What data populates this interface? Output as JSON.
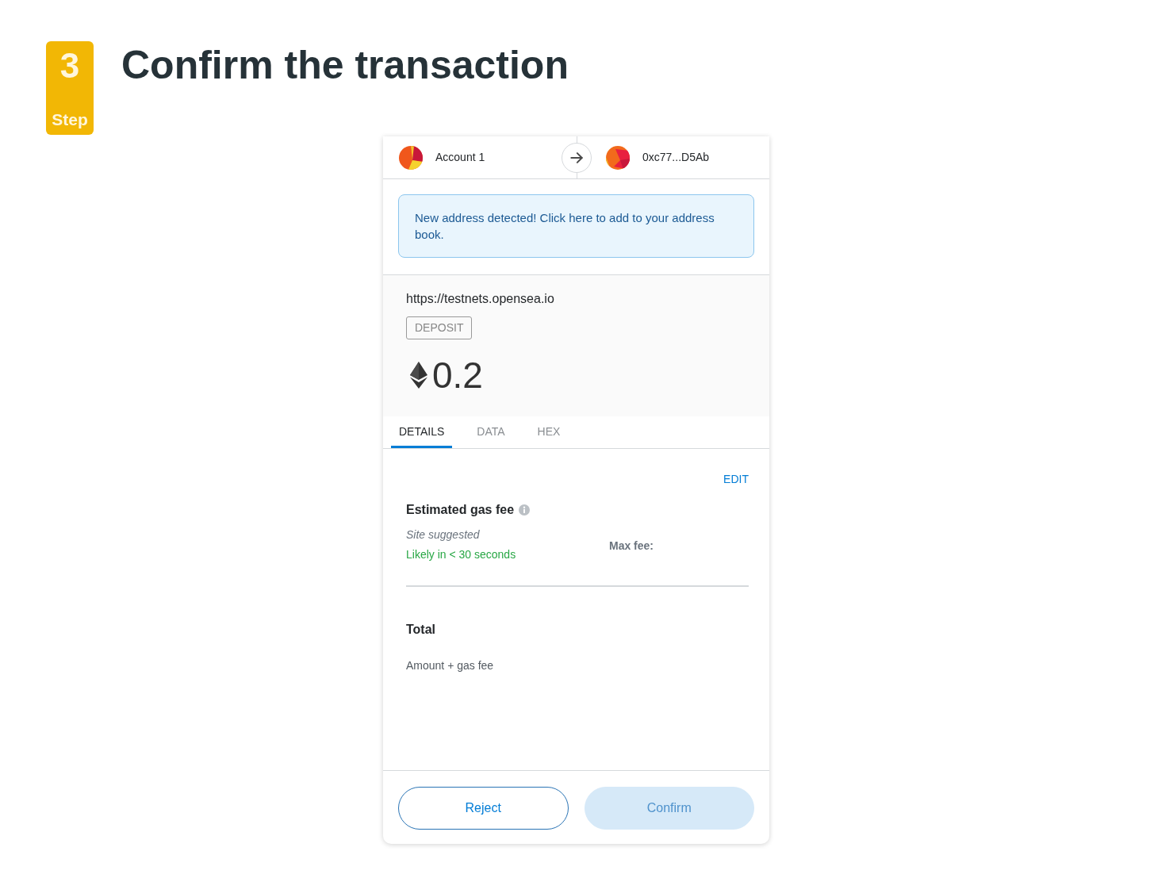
{
  "step": {
    "number": "3",
    "label": "Step"
  },
  "title": "Confirm the transaction",
  "header": {
    "from": "Account 1",
    "to": "0xc77...D5Ab"
  },
  "notice": "New address detected! Click here to add to your address book.",
  "origin": "https://testnets.opensea.io",
  "method": "DEPOSIT",
  "amount": "0.2",
  "tabs": [
    {
      "label": "DETAILS",
      "selected": true
    },
    {
      "label": "DATA",
      "selected": false
    },
    {
      "label": "HEX",
      "selected": false
    }
  ],
  "gas": {
    "edit": "EDIT",
    "label": "Estimated gas fee",
    "source": "Site suggested",
    "speed": "Likely in < 30 seconds",
    "max_fee_label": "Max fee:"
  },
  "total": {
    "label": "Total",
    "sublabel": "Amount + gas fee"
  },
  "buttons": [
    {
      "label": "Reject",
      "kind": "secondary",
      "disabled": false
    },
    {
      "label": "Confirm",
      "kind": "primary",
      "disabled": true
    }
  ]
}
